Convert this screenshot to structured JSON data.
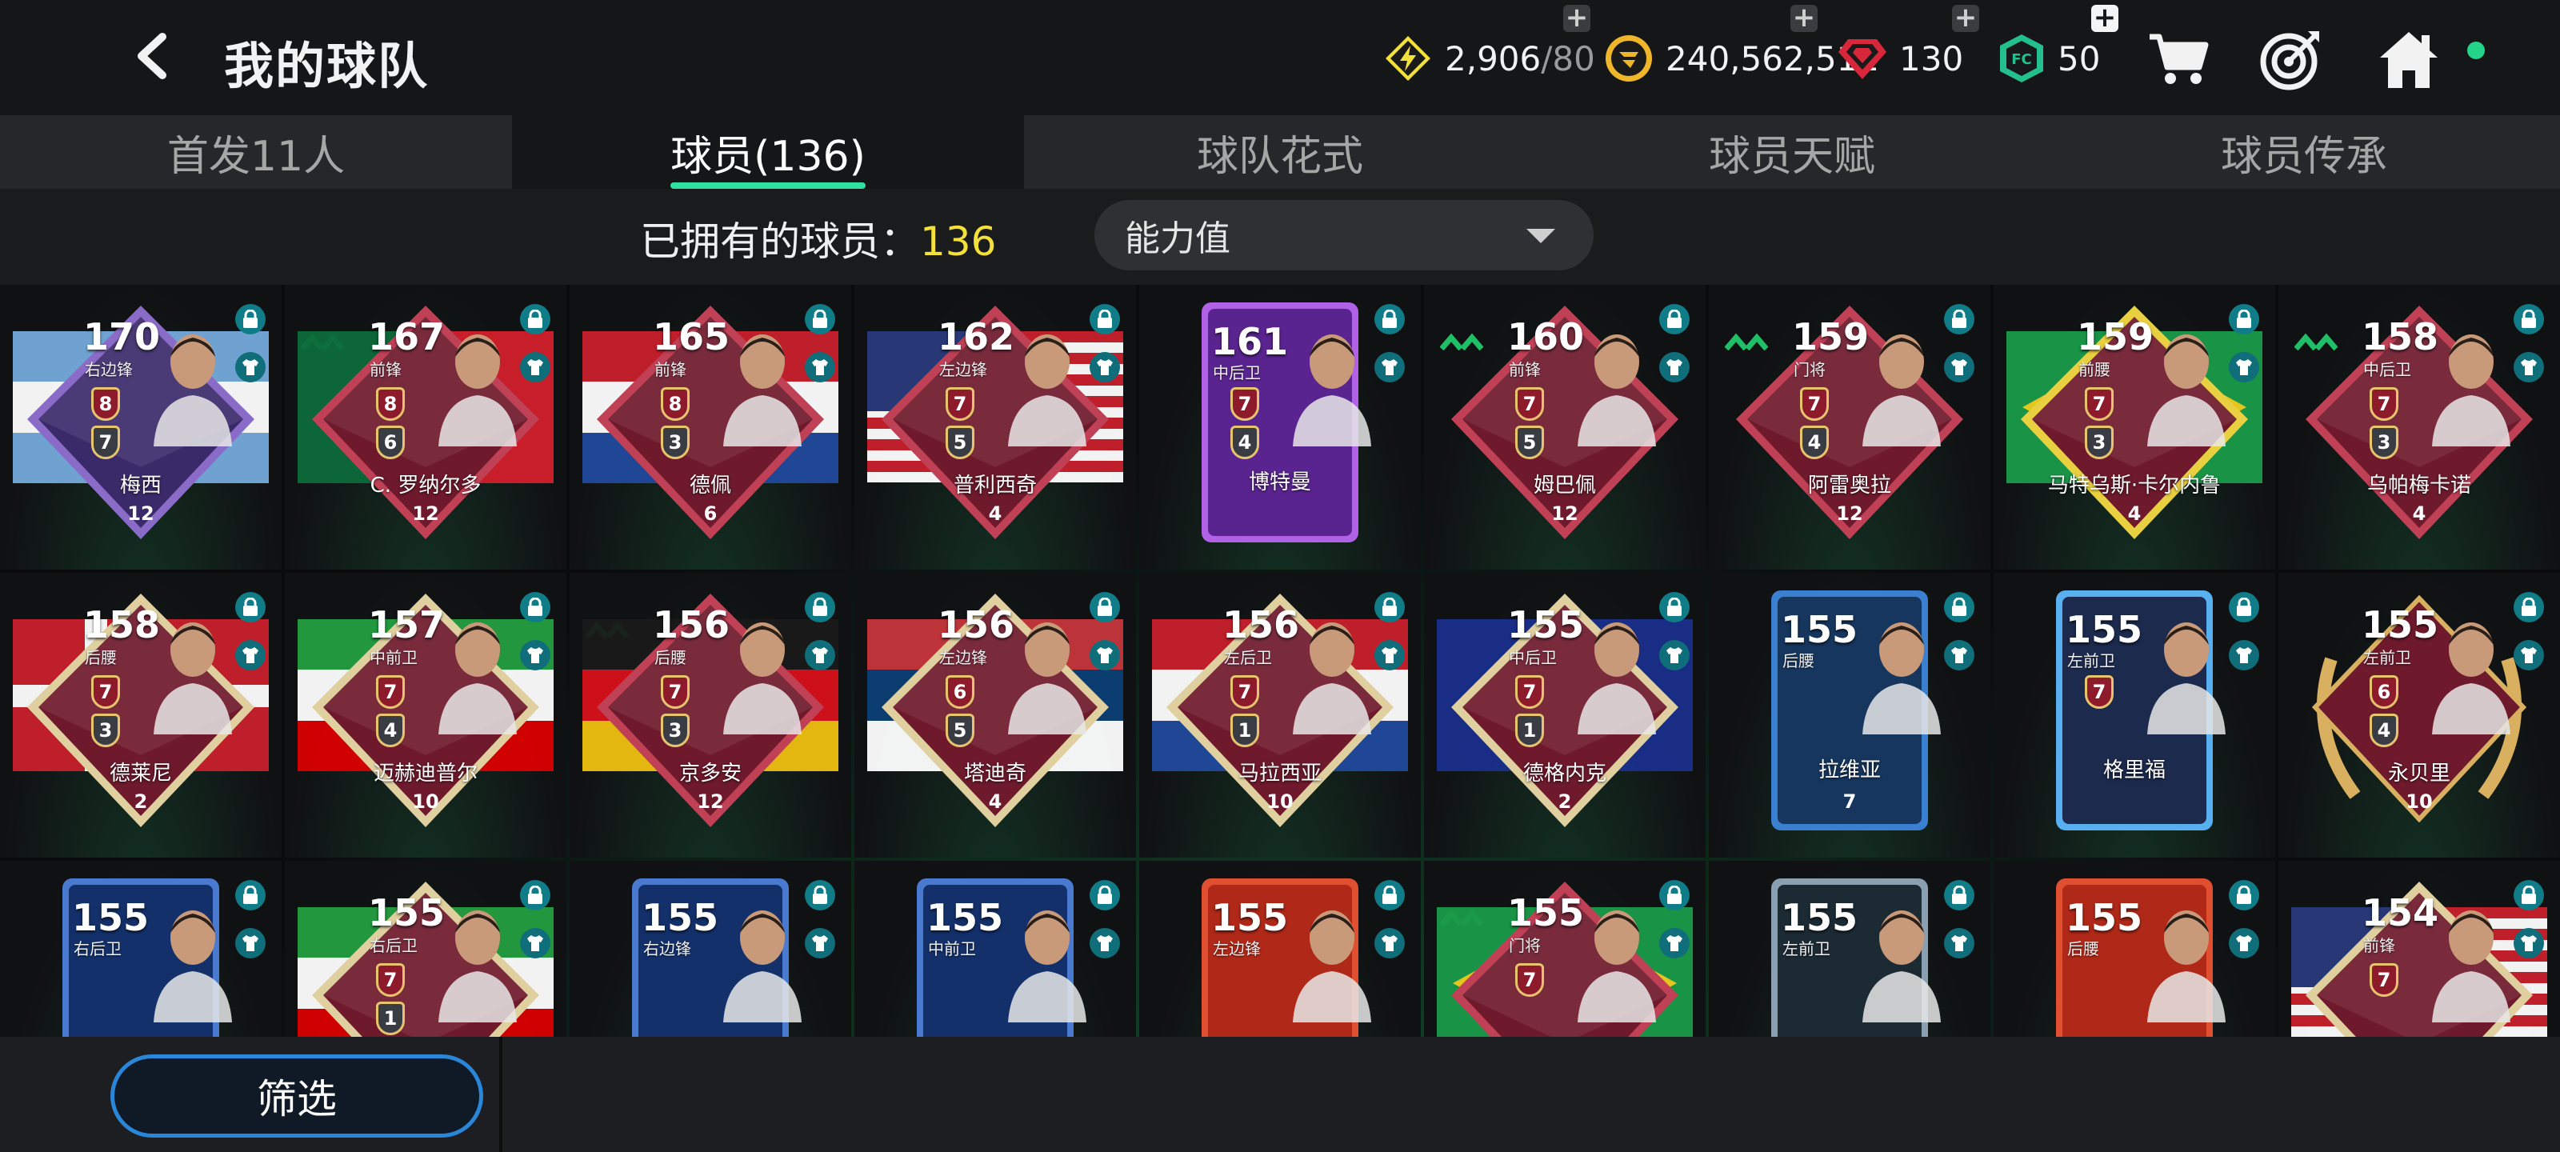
{
  "header": {
    "title": "我的球队",
    "energy": {
      "value": "2,906",
      "max": "/80"
    },
    "coins": "240,562,512",
    "gems": "130",
    "tokens": "50"
  },
  "tabs": [
    {
      "label": "首发11人"
    },
    {
      "label": "球员(136)"
    },
    {
      "label": "球队花式"
    },
    {
      "label": "球员天赋"
    },
    {
      "label": "球员传承"
    }
  ],
  "owned": {
    "label": "已拥有的球员：",
    "count": "136"
  },
  "sort": {
    "selected": "能力值"
  },
  "players": [
    {
      "ovr": "170",
      "pos": "右边锋",
      "name": "梅西",
      "grade": "12",
      "s1": "8",
      "s2": "7"
    },
    {
      "ovr": "167",
      "pos": "前锋",
      "name": "C. 罗纳尔多",
      "grade": "12",
      "s1": "8",
      "s2": "6"
    },
    {
      "ovr": "165",
      "pos": "前锋",
      "name": "德佩",
      "grade": "6",
      "s1": "8",
      "s2": "3"
    },
    {
      "ovr": "162",
      "pos": "左边锋",
      "name": "普利西奇",
      "grade": "4",
      "s1": "7",
      "s2": "5"
    },
    {
      "ovr": "161",
      "pos": "中后卫",
      "name": "博特曼",
      "grade": "",
      "s1": "7",
      "s2": "4"
    },
    {
      "ovr": "160",
      "pos": "前锋",
      "name": "姆巴佩",
      "grade": "12",
      "s1": "7",
      "s2": "5"
    },
    {
      "ovr": "159",
      "pos": "门将",
      "name": "阿雷奥拉",
      "grade": "12",
      "s1": "7",
      "s2": "4"
    },
    {
      "ovr": "159",
      "pos": "前腰",
      "name": "马特乌斯·卡尔内鲁",
      "grade": "4",
      "s1": "7",
      "s2": "3"
    },
    {
      "ovr": "158",
      "pos": "中后卫",
      "name": "乌帕梅卡诺",
      "grade": "4",
      "s1": "7",
      "s2": "3"
    },
    {
      "ovr": "158",
      "pos": "后腰",
      "name": "德莱尼",
      "grade": "2",
      "s1": "7",
      "s2": "3"
    },
    {
      "ovr": "157",
      "pos": "中前卫",
      "name": "迈赫迪普尔",
      "grade": "10",
      "s1": "7",
      "s2": "4"
    },
    {
      "ovr": "156",
      "pos": "后腰",
      "name": "京多安",
      "grade": "12",
      "s1": "7",
      "s2": "3"
    },
    {
      "ovr": "156",
      "pos": "左边锋",
      "name": "塔迪奇",
      "grade": "4",
      "s1": "6",
      "s2": "5"
    },
    {
      "ovr": "156",
      "pos": "左后卫",
      "name": "马拉西亚",
      "grade": "10",
      "s1": "7",
      "s2": "1"
    },
    {
      "ovr": "155",
      "pos": "中后卫",
      "name": "德格内克",
      "grade": "2",
      "s1": "7",
      "s2": "1"
    },
    {
      "ovr": "155",
      "pos": "后腰",
      "name": "拉维亚",
      "grade": "7",
      "s1": "",
      "s2": ""
    },
    {
      "ovr": "155",
      "pos": "左前卫",
      "name": "格里福",
      "grade": "",
      "s1": "7",
      "s2": ""
    },
    {
      "ovr": "155",
      "pos": "左前卫",
      "name": "永贝里",
      "grade": "10",
      "s1": "6",
      "s2": "4"
    },
    {
      "ovr": "155",
      "pos": "右后卫",
      "name": "",
      "grade": "",
      "s1": "",
      "s2": ""
    },
    {
      "ovr": "155",
      "pos": "右后卫",
      "name": "",
      "grade": "",
      "s1": "7",
      "s2": "1"
    },
    {
      "ovr": "155",
      "pos": "右边锋",
      "name": "",
      "grade": "",
      "s1": "",
      "s2": ""
    },
    {
      "ovr": "155",
      "pos": "中前卫",
      "name": "",
      "grade": "",
      "s1": "",
      "s2": ""
    },
    {
      "ovr": "155",
      "pos": "左边锋",
      "name": "",
      "grade": "",
      "s1": "",
      "s2": ""
    },
    {
      "ovr": "155",
      "pos": "门将",
      "name": "",
      "grade": "",
      "s1": "7",
      "s2": ""
    },
    {
      "ovr": "155",
      "pos": "左前卫",
      "name": "",
      "grade": "",
      "s1": "",
      "s2": ""
    },
    {
      "ovr": "155",
      "pos": "后腰",
      "name": "",
      "grade": "",
      "s1": "",
      "s2": ""
    },
    {
      "ovr": "154",
      "pos": "前锋",
      "name": "",
      "grade": "",
      "s1": "7",
      "s2": ""
    }
  ],
  "bottom": {
    "filter_label": "筛选"
  },
  "colors": {
    "accent": "#2fe0a0",
    "owned_count": "#f3e13a",
    "filter_border": "#2a86d8"
  }
}
